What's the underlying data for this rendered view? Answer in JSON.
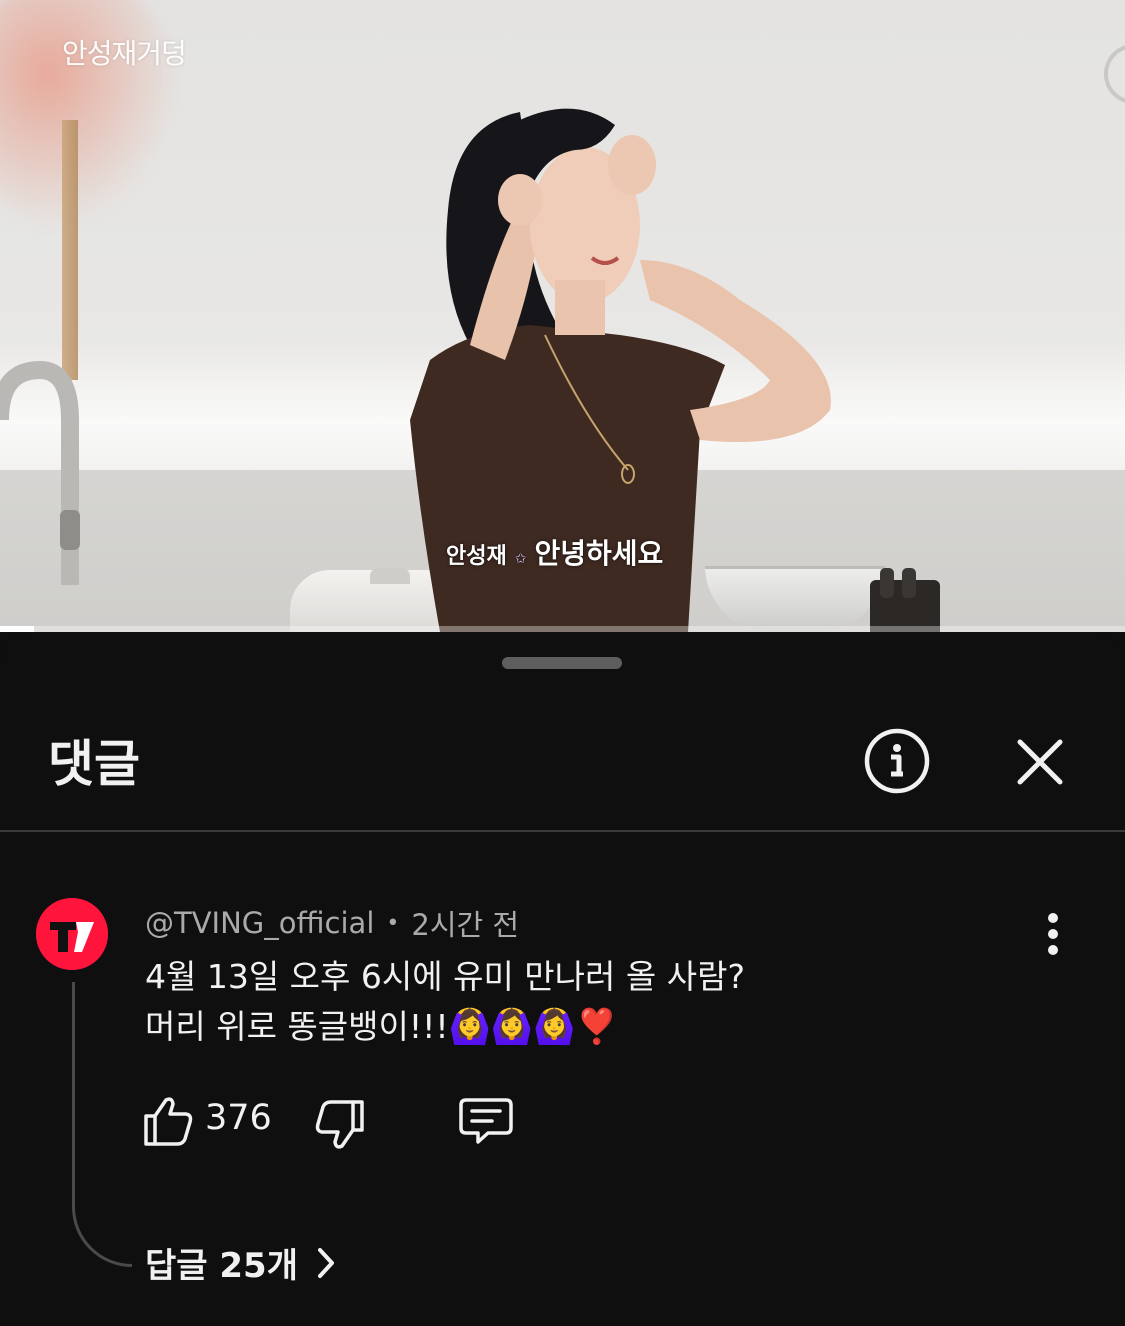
{
  "video": {
    "channel_watermark": "안성재거덩",
    "subtitle": {
      "speaker": "안성재",
      "star": "✩",
      "line": "안녕하세요"
    },
    "progress": 0.03
  },
  "comments_sheet": {
    "title": "댓글",
    "icons": {
      "info": "info-icon",
      "close": "close-icon"
    },
    "comment": {
      "author": "@TVING_official",
      "separator": "•",
      "time": "2시간 전",
      "line1": "4월 13일 오후 6시에 유미 만나러 올 사람?",
      "line2": "머리 위로 똥글뱅이!!!",
      "emojis": "🙆‍♀️🙆‍♀️🙆‍♀️❣️",
      "likes": "376",
      "avatar_color": "#ff153c"
    },
    "replies_label": "답글 25개"
  }
}
